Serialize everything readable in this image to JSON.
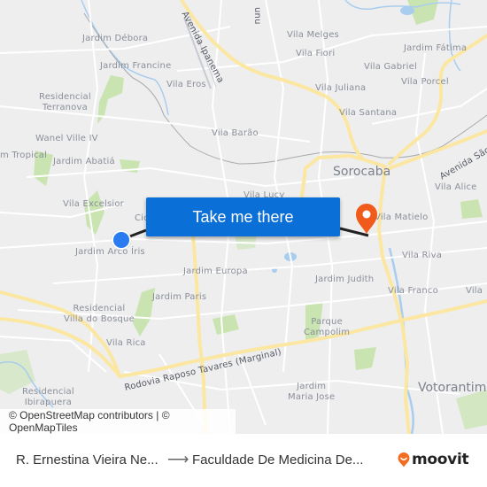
{
  "map": {
    "neighborhood_labels": [
      {
        "text": "Jardim Débora"
      },
      {
        "text": "Jardim Francine"
      },
      {
        "text": "Vila Eros"
      },
      {
        "text": "Residencial\nTerranova"
      },
      {
        "text": "Wanel Ville IV"
      },
      {
        "text": "m Tropical"
      },
      {
        "text": "Jardim Abatiá"
      },
      {
        "text": "Vila Melges"
      },
      {
        "text": "Vila Fiori"
      },
      {
        "text": "Jardim Fátima"
      },
      {
        "text": "Vila Gabriel"
      },
      {
        "text": "Vila Porcel"
      },
      {
        "text": "Vila Juliana"
      },
      {
        "text": "Vila Santana"
      },
      {
        "text": "Vila Barão"
      },
      {
        "text": "Vila Lucy"
      },
      {
        "text": "Vila Excelsior"
      },
      {
        "text": "Cid"
      },
      {
        "text": "Jardim Arco Íris"
      },
      {
        "text": "Jardim Europa"
      },
      {
        "text": "Jardim Paris"
      },
      {
        "text": "Residencial\nVilla do Bosque"
      },
      {
        "text": "Vila Rica"
      },
      {
        "text": "Vila Alice"
      },
      {
        "text": "Vila Matielo"
      },
      {
        "text": "Vila Riva"
      },
      {
        "text": "Jardim Judith"
      },
      {
        "text": "Vila Franco"
      },
      {
        "text": "Vila"
      },
      {
        "text": "Parque\nCampolim"
      },
      {
        "text": "Jardim\nMaria Jose"
      },
      {
        "text": "Residencial\nIbirapuera"
      }
    ],
    "city_labels": [
      {
        "text": "Sorocaba"
      },
      {
        "text": "Votorantim"
      }
    ],
    "road_labels": [
      {
        "text": "Avenida Ipanema"
      },
      {
        "text": "Avenida São"
      },
      {
        "text": "Rodovia Raposo Tavares (Marginal)"
      },
      {
        "text": "unu"
      }
    ],
    "take_me_there_label": "Take me there",
    "attribution": "© OpenStreetMap contributors | © OpenMapTiles",
    "colors": {
      "button": "#0a6fd6",
      "origin_dot": "#2a7af0",
      "destination_pin": "#f05a1a",
      "major_road": "#fbe7a1",
      "park": "#c9e4b0",
      "water": "#a8cdee"
    }
  },
  "footer": {
    "origin": "R. Ernestina Vieira Ne...",
    "arrow": "⟶",
    "destination": "Faculdade De Medicina De...",
    "brand": "moovit",
    "brand_color": "#f26c21"
  }
}
